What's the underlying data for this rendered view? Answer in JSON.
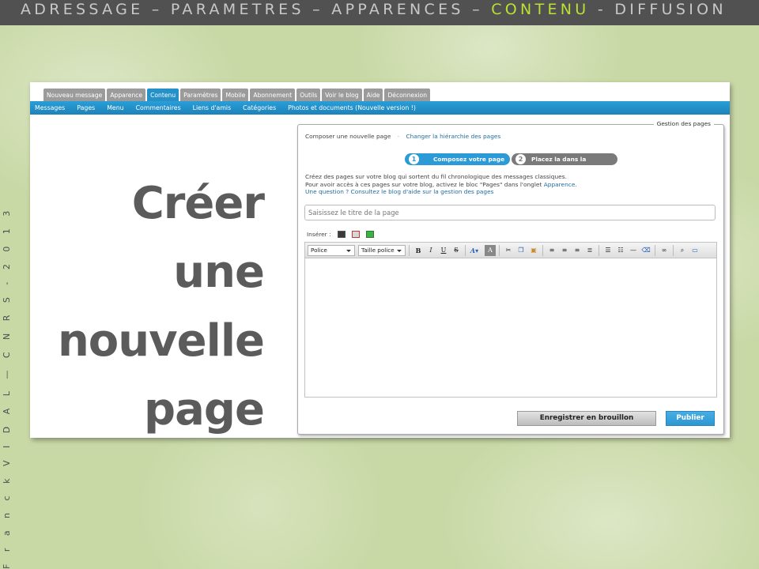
{
  "colors": {
    "background": "#c9d9a6",
    "topbar": "#515151",
    "topbar_text": "#c8c8c8",
    "topbar_active": "#b9e232",
    "tab_active": "#2591c8",
    "tab_inactive": "#9b9b9b",
    "subnav": "#1d82b9",
    "step_active": "#2b9ad6",
    "step_inactive": "#7a7a7a",
    "publish_button": "#2d97d2",
    "link": "#1f6ea1",
    "slide_title": "#5b5b5b"
  },
  "header": {
    "before": "ADRESSAGE – PARAMETRES – APPARENCES – ",
    "active": "CONTENU",
    "after": " - DIFFUSION"
  },
  "side_credit": "F r a n c k   V I D A L  —  C N R S  -  2 0 1 3",
  "slide_title": [
    "Créer",
    "une",
    "nouvelle",
    "page"
  ],
  "tabs": [
    {
      "label": "Nouveau message",
      "active": false
    },
    {
      "label": "Apparence",
      "active": false
    },
    {
      "label": "Contenu",
      "active": true
    },
    {
      "label": "Paramètres",
      "active": false
    },
    {
      "label": "Mobile",
      "active": false
    },
    {
      "label": "Abonnement",
      "active": false
    },
    {
      "label": "Outils",
      "active": false
    },
    {
      "label": "Voir le blog",
      "active": false
    },
    {
      "label": "Aide",
      "active": false
    },
    {
      "label": "Déconnexion",
      "active": false
    }
  ],
  "subnav": [
    "Messages",
    "Pages",
    "Menu",
    "Commentaires",
    "Liens d'amis",
    "Catégories",
    "Photos et documents (Nouvelle version !)"
  ],
  "box": {
    "legend": "Gestion des pages",
    "link_compose": "Composer une nouvelle page",
    "separator": "·",
    "link_hierarchy": "Changer la hiérarchie des pages",
    "step1_num": "1",
    "step1_label": "Composez votre page",
    "step2_num": "2",
    "step2_label": "Placez la dans la hiérarchie",
    "info_line1": "Créez des pages sur votre blog qui sortent du fil chronologique des messages classiques.",
    "info_line2_a": "Pour avoir accès à ces pages sur votre blog, activez le bloc \"Pages\" dans l'onglet ",
    "info_line2_link": "Apparence.",
    "info_line3": "Une question ? Consultez le blog d'aide sur la gestion des pages",
    "title_placeholder": "Saisissez le titre de la page",
    "insert_label": "Insérer :",
    "toolbar": {
      "font_select": "Police",
      "size_select": "Taille police"
    },
    "draft_button": "Enregistrer en brouillon",
    "publish_button": "Publier"
  },
  "icons": {
    "insert": [
      "image-icon",
      "gallery-icon",
      "video-icon"
    ],
    "toolbar": [
      "bold-icon",
      "italic-icon",
      "underline-icon",
      "strikethrough-icon",
      "font-color-icon",
      "highlight-color-icon",
      "cut-icon",
      "copy-icon",
      "paste-icon",
      "align-left-icon",
      "align-center-icon",
      "align-right-icon",
      "justify-icon",
      "bulleted-list-icon",
      "numbered-list-icon",
      "horizontal-rule-icon",
      "eraser-icon",
      "link-icon",
      "find-icon",
      "image-insert-icon"
    ]
  }
}
